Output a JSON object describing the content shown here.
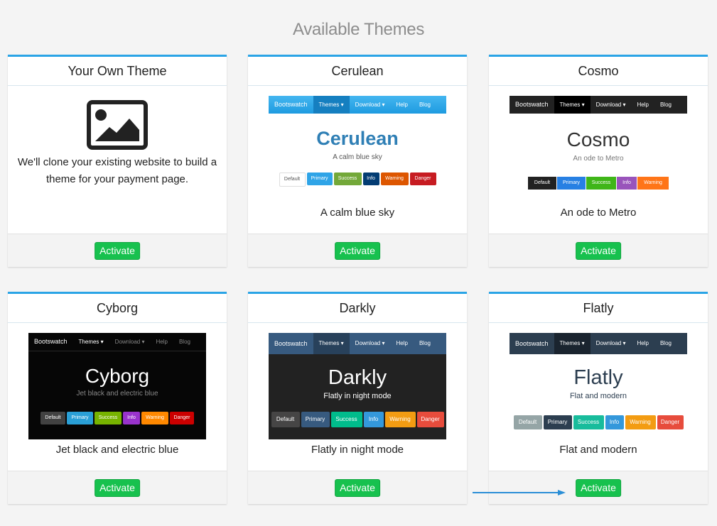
{
  "page": {
    "title": "Available Themes",
    "activate_label": "Activate"
  },
  "colors": {
    "accent": "#2aa4e6",
    "activate": "#17c14e",
    "arrow": "#2a8ed6"
  },
  "themes": [
    {
      "name": "Your Own Theme",
      "description": "We'll clone your existing website to build a theme for your payment page.",
      "icon": "image-icon"
    },
    {
      "name": "Cerulean",
      "caption": "A calm blue sky",
      "preview": {
        "brand": "Bootswatch",
        "nav": [
          "Themes ▾",
          "Download ▾",
          "Help",
          "Blog"
        ],
        "title": "Cerulean",
        "subtitle": "A calm blue sky",
        "buttons": [
          "Default",
          "Primary",
          "Success",
          "Info",
          "Warning",
          "Danger"
        ]
      }
    },
    {
      "name": "Cosmo",
      "caption": "An ode to Metro",
      "preview": {
        "brand": "Bootswatch",
        "nav": [
          "Themes ▾",
          "Download ▾",
          "Help",
          "Blog"
        ],
        "title": "Cosmo",
        "subtitle": "An ode to Metro",
        "buttons": [
          "Default",
          "Primary",
          "Success",
          "Info",
          "Warning"
        ]
      }
    },
    {
      "name": "Cyborg",
      "caption": "Jet black and electric blue",
      "preview": {
        "brand": "Bootswatch",
        "nav": [
          "Themes ▾",
          "Download ▾",
          "Help",
          "Blog"
        ],
        "title": "Cyborg",
        "subtitle": "Jet black and electric blue",
        "buttons": [
          "Default",
          "Primary",
          "Success",
          "Info",
          "Warning",
          "Danger"
        ]
      }
    },
    {
      "name": "Darkly",
      "caption": "Flatly in night mode",
      "preview": {
        "brand": "Bootswatch",
        "nav": [
          "Themes ▾",
          "Download ▾",
          "Help",
          "Blog"
        ],
        "title": "Darkly",
        "subtitle": "Flatly in night mode",
        "buttons": [
          "Default",
          "Primary",
          "Success",
          "Info",
          "Warning",
          "Danger"
        ]
      }
    },
    {
      "name": "Flatly",
      "caption": "Flat and modern",
      "preview": {
        "brand": "Bootswatch",
        "nav": [
          "Themes ▾",
          "Download ▾",
          "Help",
          "Blog"
        ],
        "title": "Flatly",
        "subtitle": "Flat and modern",
        "buttons": [
          "Default",
          "Primary",
          "Success",
          "Info",
          "Warning",
          "Danger"
        ]
      }
    }
  ]
}
